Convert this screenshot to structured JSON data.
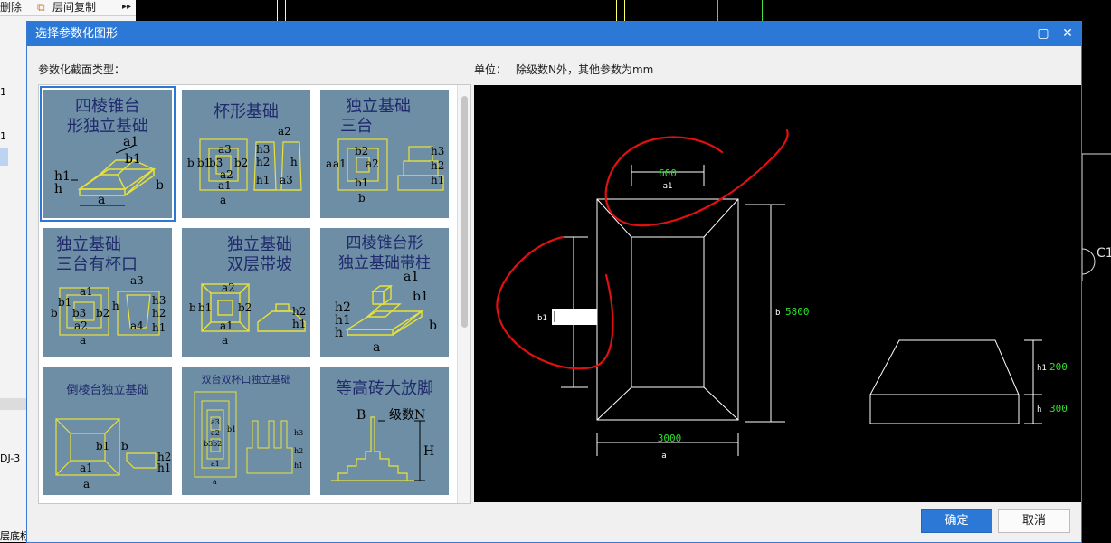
{
  "background_app": {
    "toolbar": {
      "delete_label": "删除",
      "copy_floors_label": "层间复制",
      "more_icon": "double-chevron-right-icon"
    },
    "left_items": [
      "1",
      "1",
      "DJ-3",
      "层底标"
    ],
    "right_label": "C1"
  },
  "dialog": {
    "title": "选择参数化图形",
    "section_type_label": "参数化截面类型：",
    "unit_label": "单位：",
    "unit_text": "除级数N外，其他参数为mm",
    "ok_label": "确定",
    "cancel_label": "取消",
    "shapes": [
      {
        "title_line1": "四棱锥台",
        "title_line2": "形独立基础",
        "selected": true
      },
      {
        "title_line1": "杯形基础",
        "title_line2": ""
      },
      {
        "title_line1": "独立基础",
        "title_line2": "三台"
      },
      {
        "title_line1": "独立基础",
        "title_line2": "三台有杯口"
      },
      {
        "title_line1": "独立基础",
        "title_line2": "双层带坡"
      },
      {
        "title_line1": "四棱锥台形",
        "title_line2": "独立基础带柱"
      },
      {
        "title_line1": "倒棱台独立基础",
        "title_line2": ""
      },
      {
        "title_line1": "双台双杯口独立基础",
        "title_line2": ""
      },
      {
        "title_line1": "等高砖大放脚",
        "title_line2": ""
      }
    ],
    "thumb_labels": {
      "t1": [
        "a1",
        "b1",
        "h1",
        "h",
        "a",
        "b"
      ],
      "t2": [
        "a3",
        "b3",
        "b2",
        "a2",
        "b",
        "b1",
        "a1",
        "a",
        "h3",
        "h2",
        "h1",
        "h",
        "a2",
        "a3"
      ],
      "t3": [
        "a",
        "b2",
        "a1",
        "a2",
        "b1",
        "b",
        "h3",
        "h2",
        "h1"
      ],
      "t4": [
        "a1",
        "a3",
        "b1",
        "b3",
        "b",
        "b2",
        "a2",
        "a",
        "h",
        "a4",
        "h3",
        "h2",
        "h1"
      ],
      "t5": [
        "a2",
        "b",
        "b1",
        "b2",
        "a1",
        "a",
        "h2",
        "h1"
      ],
      "t6": [
        "a1",
        "b1",
        "h2",
        "h1",
        "h",
        "a",
        "b"
      ],
      "t7": [
        "b1",
        "b",
        "a1",
        "a",
        "h2",
        "h1"
      ],
      "t8": [
        "a3",
        "b3",
        "a2",
        "b2",
        "a1",
        "b1",
        "a",
        "h3",
        "h2",
        "h1"
      ],
      "t9": [
        "B",
        "级数N",
        "H"
      ]
    },
    "preview": {
      "top_width_value": "600",
      "top_width_param": "a1",
      "length_param": "b",
      "length_value": "5800",
      "left_param": "b1",
      "left_value": "",
      "bottom_width_value": "3000",
      "bottom_width_param": "a",
      "h1_param": "h1",
      "h1_value": "200",
      "h_param": "h",
      "h_value": "300"
    },
    "colors": {
      "title_bar": "#2b78d6",
      "value_green": "#2fe02f",
      "annotation_red": "#e01010",
      "thumb_bg": "#6e8ea5",
      "thumb_line": "#e8e23a"
    }
  }
}
